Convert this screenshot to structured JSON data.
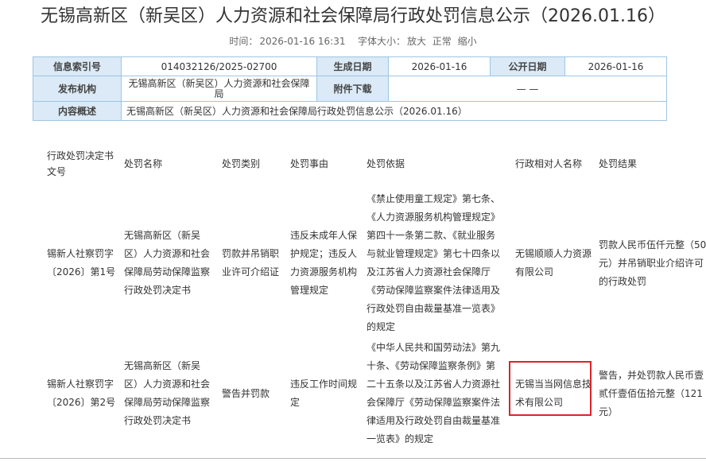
{
  "title": "无锡高新区（新吴区）人力资源和社会保障局行政处罚信息公示（2026.01.16）",
  "meta": {
    "time_label": "时间：",
    "time": "2026-01-16 16:31",
    "font_label": "字体大小：",
    "font_large": "放大",
    "font_normal": "正常",
    "font_small": "缩小"
  },
  "info": {
    "index_label": "信息索引号",
    "index": "014032126/2025-02700",
    "gen_date_label": "生成日期",
    "gen_date": "2026-01-16",
    "pub_date_label": "公开日期",
    "pub_date": "2026-01-16",
    "org_label": "发布机构",
    "org_line1": "无锡高新区（新吴区）人力资源和社会保障",
    "org_line2": "局",
    "attach_label": "附件下载",
    "attach": "— —",
    "summary_label": "内容概述",
    "summary": "无锡高新区（新吴区）人力资源和社会保障局行政处罚信息公示（2026.01.16）"
  },
  "headers": {
    "doc_no_1": "行政处罚决定书",
    "doc_no_2": "文号",
    "name": "处罚名称",
    "type": "处罚类别",
    "reason": "处罚事由",
    "basis": "处罚依据",
    "party": "行政相对人名称",
    "result": "处罚结果"
  },
  "rows": [
    {
      "doc_no": [
        "锡新人社察罚字",
        "〔2026〕第1号"
      ],
      "name": [
        "无锡高新区（新吴",
        "区）人力资源和社会",
        "保障局劳动保障监察",
        "行政处罚决定书"
      ],
      "type": [
        "罚款并吊销职",
        "业许可介绍证"
      ],
      "reason": [
        "违反未成年人保",
        "护规定；违反人",
        "力资源服务机构",
        "管理规定"
      ],
      "basis": [
        "《禁止使用童工规定》第七条、",
        "《人力资源服务机构管理规定》",
        "第四十一条第二款、《就业服务",
        "与就业管理规定》第七十四条以",
        "及江苏省人力资源社会保障厅",
        "《劳动保障监察案件法律适用及",
        "行政处罚自由裁量基准一览表》",
        "的规定"
      ],
      "party": [
        "无锡顺顺人力资源",
        "有限公司"
      ],
      "result": [
        "罚款人民币伍仟元整（50",
        "元）并吊销职业介绍许可",
        "的行政处罚"
      ]
    },
    {
      "doc_no": [
        "锡新人社察罚字",
        "〔2026〕第2号"
      ],
      "name": [
        "无锡高新区（新吴",
        "区）人力资源和社会",
        "保障局劳动保障监察",
        "行政处罚决定书"
      ],
      "type": [
        "警告并罚款"
      ],
      "reason": [
        "违反工作时间规",
        "定"
      ],
      "basis": [
        "《中华人民共和国劳动法》第九",
        "十条、《劳动保障监察条例》第",
        "二十五条以及江苏省人力资源社",
        "会保障厅《劳动保障监察案件法",
        "律适用及行政处罚自由裁量基准",
        "一览表》的规定"
      ],
      "party": [
        "无锡当当网信息技",
        "术有限公司"
      ],
      "result": [
        "警告，并处罚款人民币壹",
        "贰仟壹佰伍拾元整（121",
        "元）"
      ]
    }
  ]
}
